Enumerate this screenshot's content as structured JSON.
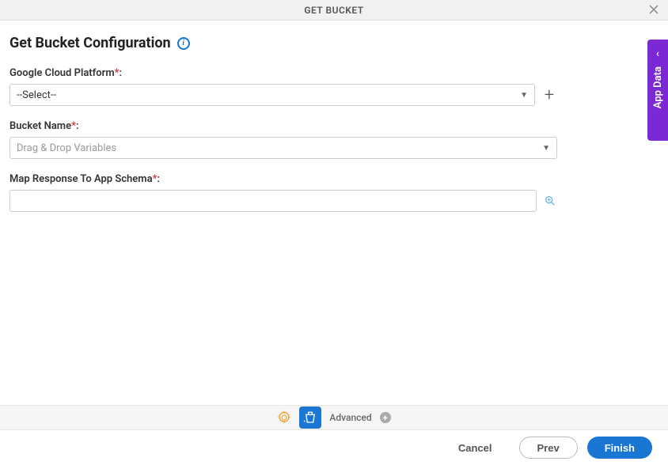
{
  "header": {
    "title": "GET BUCKET"
  },
  "page": {
    "title": "Get Bucket Configuration"
  },
  "form": {
    "platform": {
      "label": "Google Cloud Platform",
      "value": "--Select--"
    },
    "bucket": {
      "label": "Bucket Name",
      "placeholder": "Drag & Drop Variables"
    },
    "response": {
      "label": "Map Response To App Schema"
    }
  },
  "toolbar": {
    "advanced_label": "Advanced"
  },
  "footer": {
    "cancel": "Cancel",
    "prev": "Prev",
    "finish": "Finish"
  },
  "side": {
    "label": "App Data"
  }
}
